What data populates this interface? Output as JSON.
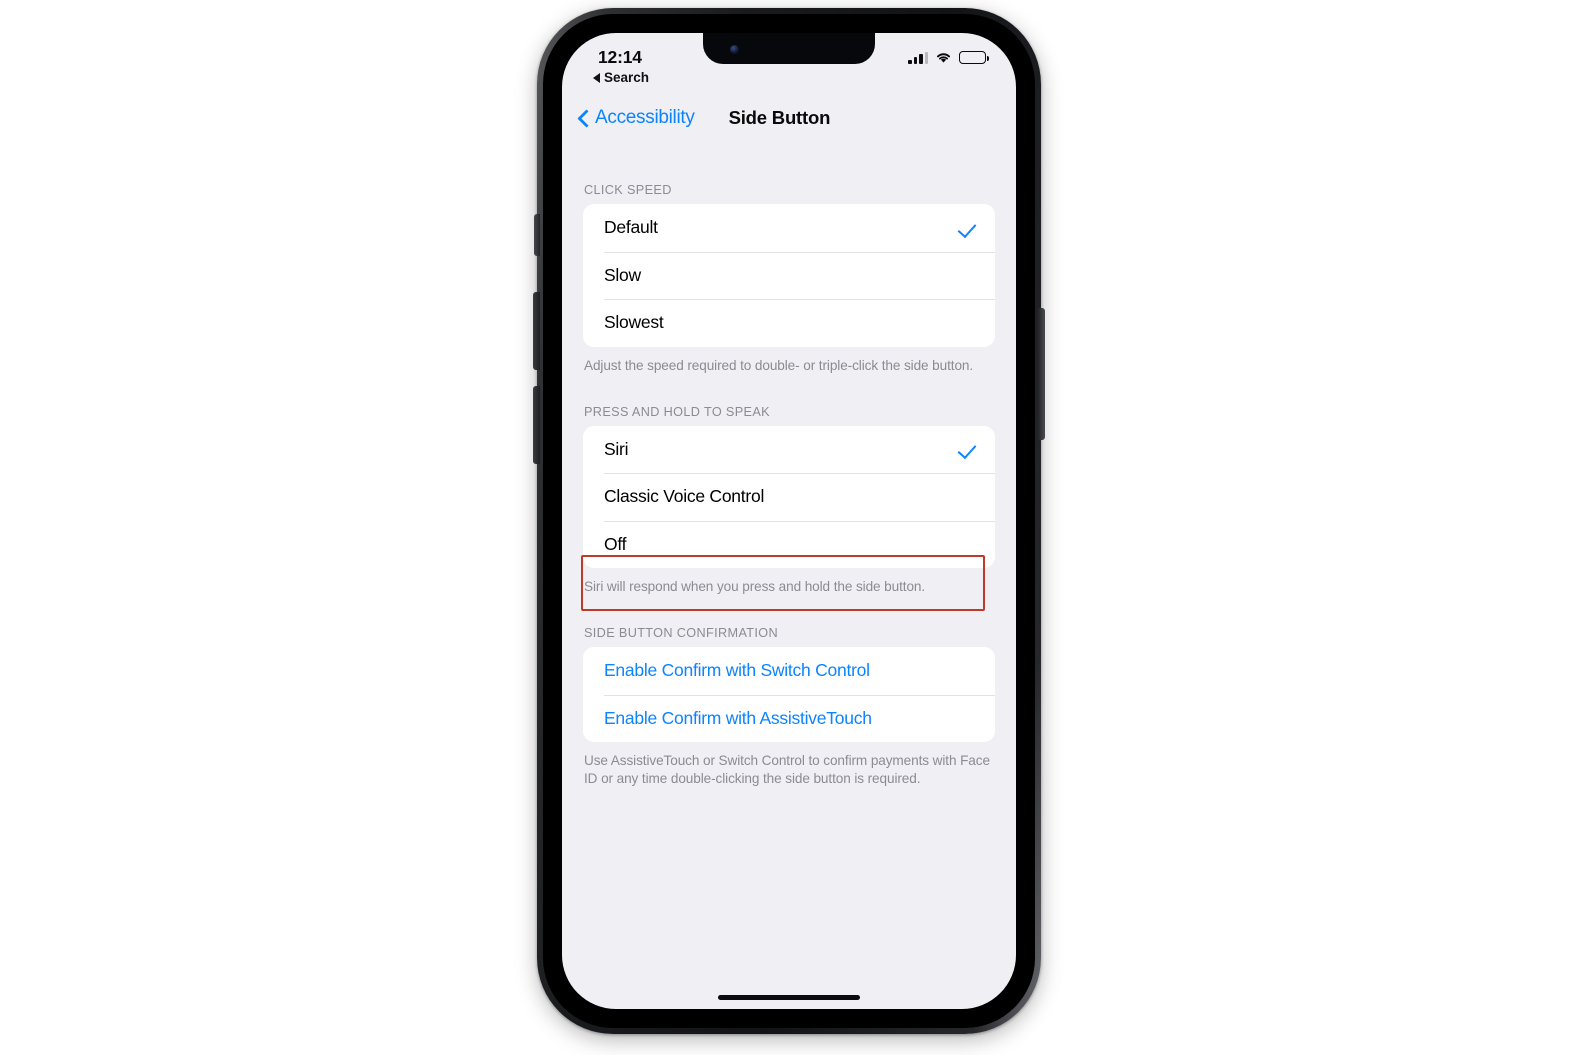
{
  "status_bar": {
    "time": "12:14",
    "back_to_app_label": "Search",
    "cellular_icon": "cellular-signal-icon",
    "wifi_icon": "wifi-icon",
    "battery_icon": "battery-icon"
  },
  "nav": {
    "back_label": "Accessibility",
    "title": "Side Button",
    "back_icon": "chevron-left-icon"
  },
  "sections": [
    {
      "header": "CLICK SPEED",
      "rows": [
        {
          "label": "Default",
          "checked": true
        },
        {
          "label": "Slow",
          "checked": false
        },
        {
          "label": "Slowest",
          "checked": false
        }
      ],
      "footnote": "Adjust the speed required to double- or triple-click the side button."
    },
    {
      "header": "PRESS AND HOLD TO SPEAK",
      "rows": [
        {
          "label": "Siri",
          "checked": true
        },
        {
          "label": "Classic Voice Control",
          "checked": false
        },
        {
          "label": "Off",
          "checked": false
        }
      ],
      "footnote": "Siri will respond when you press and hold the side button."
    },
    {
      "header": "SIDE BUTTON CONFIRMATION",
      "rows": [
        {
          "label": "Enable Confirm with Switch Control",
          "link": true
        },
        {
          "label": "Enable Confirm with AssistiveTouch",
          "link": true
        }
      ],
      "footnote": "Use AssistiveTouch or Switch Control to confirm payments with Face ID or any time double-clicking the side button is required."
    }
  ],
  "annotation": {
    "target_row_label": "Off",
    "border_color": "#c0392b"
  },
  "colors": {
    "accent_blue": "#0b84ff",
    "screen_background": "#f0eff4",
    "card_background": "#ffffff",
    "secondary_text": "#8b8b92",
    "separator": "#e3e3e7"
  }
}
